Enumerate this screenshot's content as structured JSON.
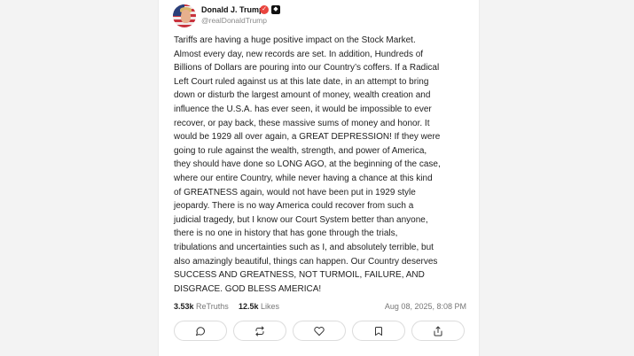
{
  "post": {
    "author_name": "Donald J. Trump",
    "author_handle": "@realDonaldTrump",
    "lines": [
      "Tariffs are having a huge positive impact on the Stock Market.",
      "Almost every day, new records are set. In addition, Hundreds of",
      "Billions of Dollars are pouring into our Country’s coffers. If a Radical",
      "Left Court ruled against us at this late date, in an attempt to bring",
      "down or disturb the largest amount of money, wealth creation and",
      "influence the U.S.A. has ever seen, it would be impossible to ever",
      "recover, or pay back, these massive sums of money and honor. It",
      "would be 1929 all over again, a GREAT DEPRESSION! If they were",
      "going to rule against the wealth, strength, and power of America,",
      "they should have done so LONG AGO, at the beginning of the case,",
      "where our entire Country, while never having a chance at this kind",
      "of GREATNESS again, would not have been put in 1929 style",
      "jeopardy. There is no way America could recover from such a",
      "judicial tragedy, but I know our Court System better than anyone,",
      "there is no one in history that has gone through the trials,",
      "tribulations and uncertainties such as I, and absolutely terrible, but",
      "also amazingly beautiful, things can happen. Our Country deserves",
      "SUCCESS AND GREATNESS, NOT TURMOIL, FAILURE, AND",
      "DISGRACE. GOD BLESS AMERICA!"
    ],
    "retruths_count": "3.53k",
    "retruths_label": "ReTruths",
    "likes_count": "12.5k",
    "likes_label": "Likes",
    "date": "Aug 08, 2025, 8:08 PM"
  },
  "actions": [
    {
      "name": "reply-button",
      "icon": "comment-icon"
    },
    {
      "name": "retruth-button",
      "icon": "repost-icon"
    },
    {
      "name": "like-button",
      "icon": "heart-icon"
    },
    {
      "name": "bookmark-button",
      "icon": "bookmark-icon"
    },
    {
      "name": "share-button",
      "icon": "share-icon"
    }
  ],
  "colors": {
    "background": "#f3f3f3",
    "card": "#ffffff",
    "verified_badge": "#e9443e"
  }
}
